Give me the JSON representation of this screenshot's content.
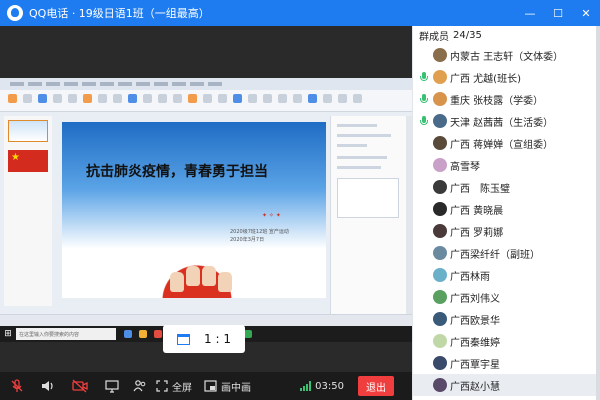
{
  "window": {
    "title": "QQ电话 · 19级日语1班（一组最高）"
  },
  "slide": {
    "headline": "抗击肺炎疫情，青春勇于担当",
    "sub1": "2020级7班12班 宣产运动",
    "sub2": "2020年3月7日"
  },
  "taskbar": {
    "search_placeholder": "在这里输入你要搜索的内容"
  },
  "ratio": {
    "label": "1 : 1"
  },
  "controls": {
    "fullscreen_label": "全屏",
    "pip_label": "画中画",
    "timer": "03:50",
    "exit_label": "退出"
  },
  "panel": {
    "title": "群成员",
    "count": "24/35"
  },
  "members": [
    {
      "name": "内蒙古 王志轩（文体委）",
      "mic": false,
      "avatar": "#8a6d4a"
    },
    {
      "name": "广西 尤越(班长)",
      "mic": true,
      "avatar": "#e0a050"
    },
    {
      "name": "重庆 张枝露（学委）",
      "mic": true,
      "avatar": "#d8944a"
    },
    {
      "name": "天津 赵茜茜（生活委）",
      "mic": true,
      "avatar": "#4a6a8a"
    },
    {
      "name": "广西 蒋婵婵（宣组委）",
      "mic": false,
      "avatar": "#5a4a3a"
    },
    {
      "name": "高雪琴",
      "mic": false,
      "avatar": "#c9a0c8"
    },
    {
      "name": "广西　陈玉璧",
      "mic": false,
      "avatar": "#3a3a3a"
    },
    {
      "name": "广西 黄晓晨",
      "mic": false,
      "avatar": "#2a2a2a"
    },
    {
      "name": "广西 罗莉娜",
      "mic": false,
      "avatar": "#4a3a3a"
    },
    {
      "name": "广西梁纤纤（副班）",
      "mic": false,
      "avatar": "#6a8aa0"
    },
    {
      "name": "广西林雨",
      "mic": false,
      "avatar": "#6ab0c8"
    },
    {
      "name": "广西刘伟义",
      "mic": false,
      "avatar": "#5aa060"
    },
    {
      "name": "广西欧景华",
      "mic": false,
      "avatar": "#3a5a7a"
    },
    {
      "name": "广西秦维婷",
      "mic": false,
      "avatar": "#c0d8a8"
    },
    {
      "name": "广西覃宇星",
      "mic": false,
      "avatar": "#3a4a6a"
    },
    {
      "name": "广西赵小慧",
      "mic": false,
      "avatar": "#5a4a6a",
      "selected": true
    }
  ]
}
